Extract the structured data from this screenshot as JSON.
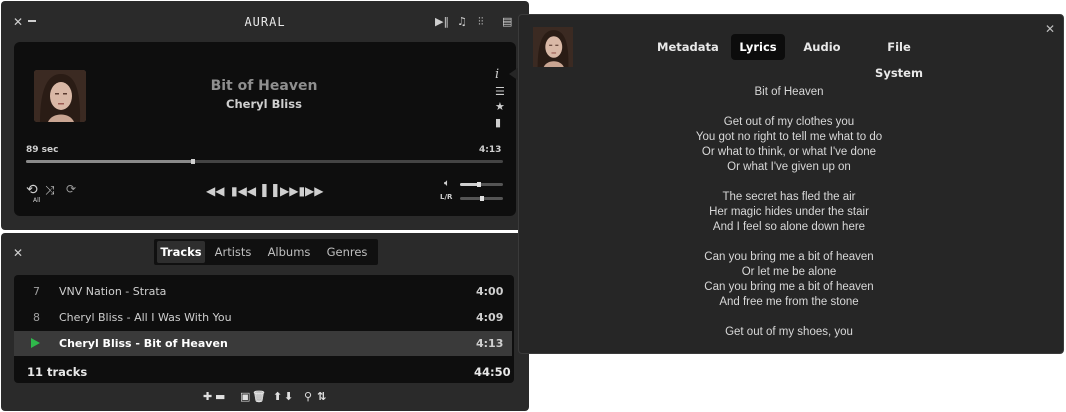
{
  "player": {
    "app_title": "AURAL",
    "track_title": "Bit of Heaven",
    "track_artist": "Cheryl Bliss",
    "elapsed": "89 sec",
    "duration": "4:13",
    "seek_progress": 0.35,
    "repeat_mode": "All",
    "volume_level": 0.45,
    "balance_label": "L/R",
    "balance_level": 0.5
  },
  "playlist": {
    "tabs": [
      "Tracks",
      "Artists",
      "Albums",
      "Genres"
    ],
    "active_tab": "Tracks",
    "tracks": [
      {
        "num": "7",
        "title": "VNV Nation - Strata",
        "duration": "4:00",
        "playing": false
      },
      {
        "num": "8",
        "title": "Cheryl Bliss - All I Was With You",
        "duration": "4:09",
        "playing": false
      },
      {
        "num": "",
        "title": "Cheryl Bliss - Bit of Heaven",
        "duration": "4:13",
        "playing": true
      }
    ],
    "summary_count": "11 tracks",
    "summary_duration": "44:50"
  },
  "popover": {
    "tabs": [
      "Metadata",
      "Lyrics",
      "Audio",
      "File System"
    ],
    "active_tab": "Lyrics",
    "lyrics": [
      "Bit of Heaven",
      "",
      "Get out of my clothes you",
      "You got no right to tell me what to do",
      "Or what to think, or what I've done",
      "Or what I've given up on",
      "",
      "The secret has fled the air",
      "Her magic hides under the stair",
      "And I feel so alone down here",
      "",
      "Can you bring me a bit of heaven",
      "Or let me be alone",
      "Can you bring me a bit of heaven",
      "And free me from the stone",
      "",
      "Get out of my shoes, you"
    ]
  },
  "colors": {
    "window_bg": "#2a2a2a",
    "panel_bg": "#0e0e0e",
    "playing_indicator": "#2fb84b"
  }
}
